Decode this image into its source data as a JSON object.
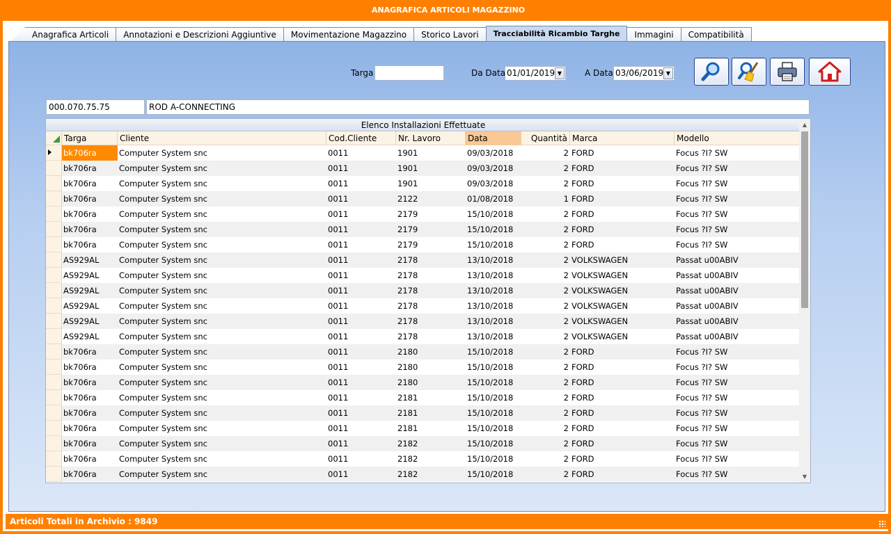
{
  "window": {
    "title": "ANAGRAFICA ARTICOLI MAGAZZINO"
  },
  "tabs": [
    {
      "label": "Anagrafica Articoli"
    },
    {
      "label": "Annotazioni  e Descrizioni Aggiuntive"
    },
    {
      "label": "Movimentazione Magazzino"
    },
    {
      "label": "Storico Lavori"
    },
    {
      "label": "Tracciabilità Ricambio Targhe"
    },
    {
      "label": "Immagini"
    },
    {
      "label": "Compatibilità"
    }
  ],
  "filters": {
    "targa_label": "Targa",
    "targa_value": "",
    "da_data_label": "Da Data",
    "da_data_value": "01/01/2019",
    "a_data_label": "A Data",
    "a_data_value": "03/06/2019"
  },
  "article": {
    "code": "000.070.75.75",
    "description": "ROD A-CONNECTING"
  },
  "toolbar": {
    "search_icon": "magnifier-icon",
    "clear_icon": "broom-icon",
    "print_icon": "printer-icon",
    "home_icon": "home-icon"
  },
  "grid": {
    "caption": "Elenco Installazioni Effettuate",
    "columns": [
      "Targa",
      "Cliente",
      "Cod.Cliente",
      "Nr. Lavoro",
      "Data",
      "Quantità",
      "Marca",
      "Modello"
    ],
    "rows": [
      [
        "bk706ra",
        "Computer System snc",
        "0011",
        "1901",
        "09/03/2018",
        "2",
        "FORD",
        "Focus ?I? SW"
      ],
      [
        "bk706ra",
        "Computer System snc",
        "0011",
        "1901",
        "09/03/2018",
        "2",
        "FORD",
        "Focus ?I? SW"
      ],
      [
        "bk706ra",
        "Computer System snc",
        "0011",
        "1901",
        "09/03/2018",
        "2",
        "FORD",
        "Focus ?I? SW"
      ],
      [
        "bk706ra",
        "Computer System snc",
        "0011",
        "2122",
        "01/08/2018",
        "1",
        "FORD",
        "Focus ?I? SW"
      ],
      [
        "bk706ra",
        "Computer System snc",
        "0011",
        "2179",
        "15/10/2018",
        "2",
        "FORD",
        "Focus ?I? SW"
      ],
      [
        "bk706ra",
        "Computer System snc",
        "0011",
        "2179",
        "15/10/2018",
        "2",
        "FORD",
        "Focus ?I? SW"
      ],
      [
        "bk706ra",
        "Computer System snc",
        "0011",
        "2179",
        "15/10/2018",
        "2",
        "FORD",
        "Focus ?I? SW"
      ],
      [
        "AS929AL",
        "Computer System snc",
        "0011",
        "2178",
        "13/10/2018",
        "2",
        "VOLKSWAGEN",
        "Passat u00ABIV"
      ],
      [
        "AS929AL",
        "Computer System snc",
        "0011",
        "2178",
        "13/10/2018",
        "2",
        "VOLKSWAGEN",
        "Passat u00ABIV"
      ],
      [
        "AS929AL",
        "Computer System snc",
        "0011",
        "2178",
        "13/10/2018",
        "2",
        "VOLKSWAGEN",
        "Passat u00ABIV"
      ],
      [
        "AS929AL",
        "Computer System snc",
        "0011",
        "2178",
        "13/10/2018",
        "2",
        "VOLKSWAGEN",
        "Passat u00ABIV"
      ],
      [
        "AS929AL",
        "Computer System snc",
        "0011",
        "2178",
        "13/10/2018",
        "2",
        "VOLKSWAGEN",
        "Passat u00ABIV"
      ],
      [
        "AS929AL",
        "Computer System snc",
        "0011",
        "2178",
        "13/10/2018",
        "2",
        "VOLKSWAGEN",
        "Passat u00ABIV"
      ],
      [
        "bk706ra",
        "Computer System snc",
        "0011",
        "2180",
        "15/10/2018",
        "2",
        "FORD",
        "Focus ?I? SW"
      ],
      [
        "bk706ra",
        "Computer System snc",
        "0011",
        "2180",
        "15/10/2018",
        "2",
        "FORD",
        "Focus ?I? SW"
      ],
      [
        "bk706ra",
        "Computer System snc",
        "0011",
        "2180",
        "15/10/2018",
        "2",
        "FORD",
        "Focus ?I? SW"
      ],
      [
        "bk706ra",
        "Computer System snc",
        "0011",
        "2181",
        "15/10/2018",
        "2",
        "FORD",
        "Focus ?I? SW"
      ],
      [
        "bk706ra",
        "Computer System snc",
        "0011",
        "2181",
        "15/10/2018",
        "2",
        "FORD",
        "Focus ?I? SW"
      ],
      [
        "bk706ra",
        "Computer System snc",
        "0011",
        "2181",
        "15/10/2018",
        "2",
        "FORD",
        "Focus ?I? SW"
      ],
      [
        "bk706ra",
        "Computer System snc",
        "0011",
        "2182",
        "15/10/2018",
        "2",
        "FORD",
        "Focus ?I? SW"
      ],
      [
        "bk706ra",
        "Computer System snc",
        "0011",
        "2182",
        "15/10/2018",
        "2",
        "FORD",
        "Focus ?I? SW"
      ],
      [
        "bk706ra",
        "Computer System snc",
        "0011",
        "2182",
        "15/10/2018",
        "2",
        "FORD",
        "Focus ?I? SW"
      ]
    ]
  },
  "status": {
    "text": "Articoli Totali in Archivio : 9849"
  }
}
